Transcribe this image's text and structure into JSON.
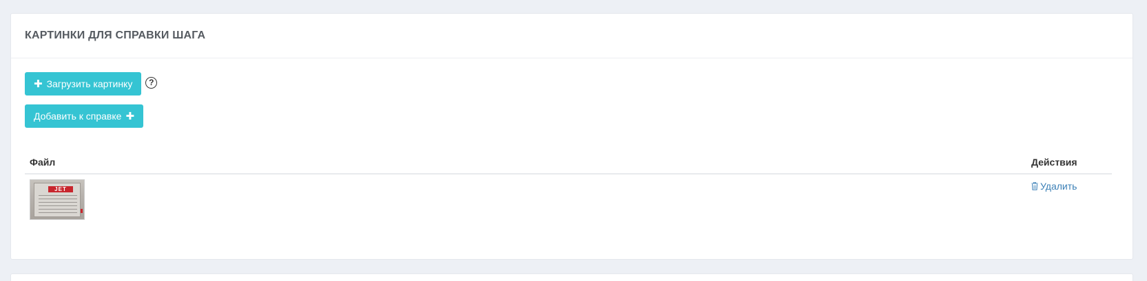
{
  "panel": {
    "title": "КАРТИНКИ ДЛЯ СПРАВКИ ШАГА"
  },
  "buttons": {
    "upload_label": "Загрузить картинку",
    "add_label": "Добавить к справке",
    "help_glyph": "?"
  },
  "table": {
    "columns": [
      "Файл",
      "Действия"
    ],
    "rows": [
      {
        "thumbnail_text": "JET",
        "action_label": "Удалить"
      }
    ]
  },
  "colors": {
    "accent": "#35c4d3",
    "link": "#3a7fb6",
    "background": "#edf0f5"
  },
  "icons": {
    "upload": "plus-icon",
    "add": "plus-icon",
    "help": "question-circle-icon",
    "delete": "trash-icon"
  }
}
